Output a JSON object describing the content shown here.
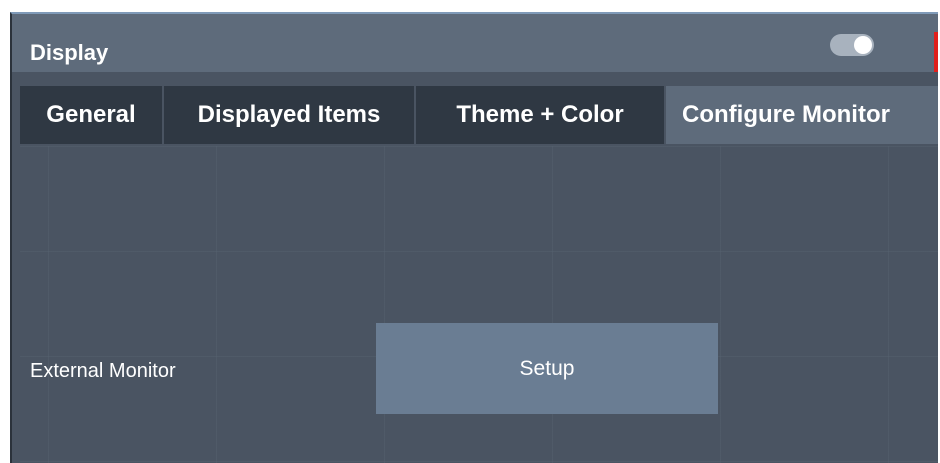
{
  "dialog": {
    "title": "Display",
    "toggle_state": "on",
    "accent_color": "#e0201c"
  },
  "tabs": [
    {
      "label": "General",
      "active": false
    },
    {
      "label": "Displayed Items",
      "active": false
    },
    {
      "label": "Theme + Color",
      "active": false
    },
    {
      "label": "Configure Monitor",
      "active": true
    }
  ],
  "content": {
    "external_monitor_label": "External Monitor",
    "setup_button_label": "Setup"
  }
}
